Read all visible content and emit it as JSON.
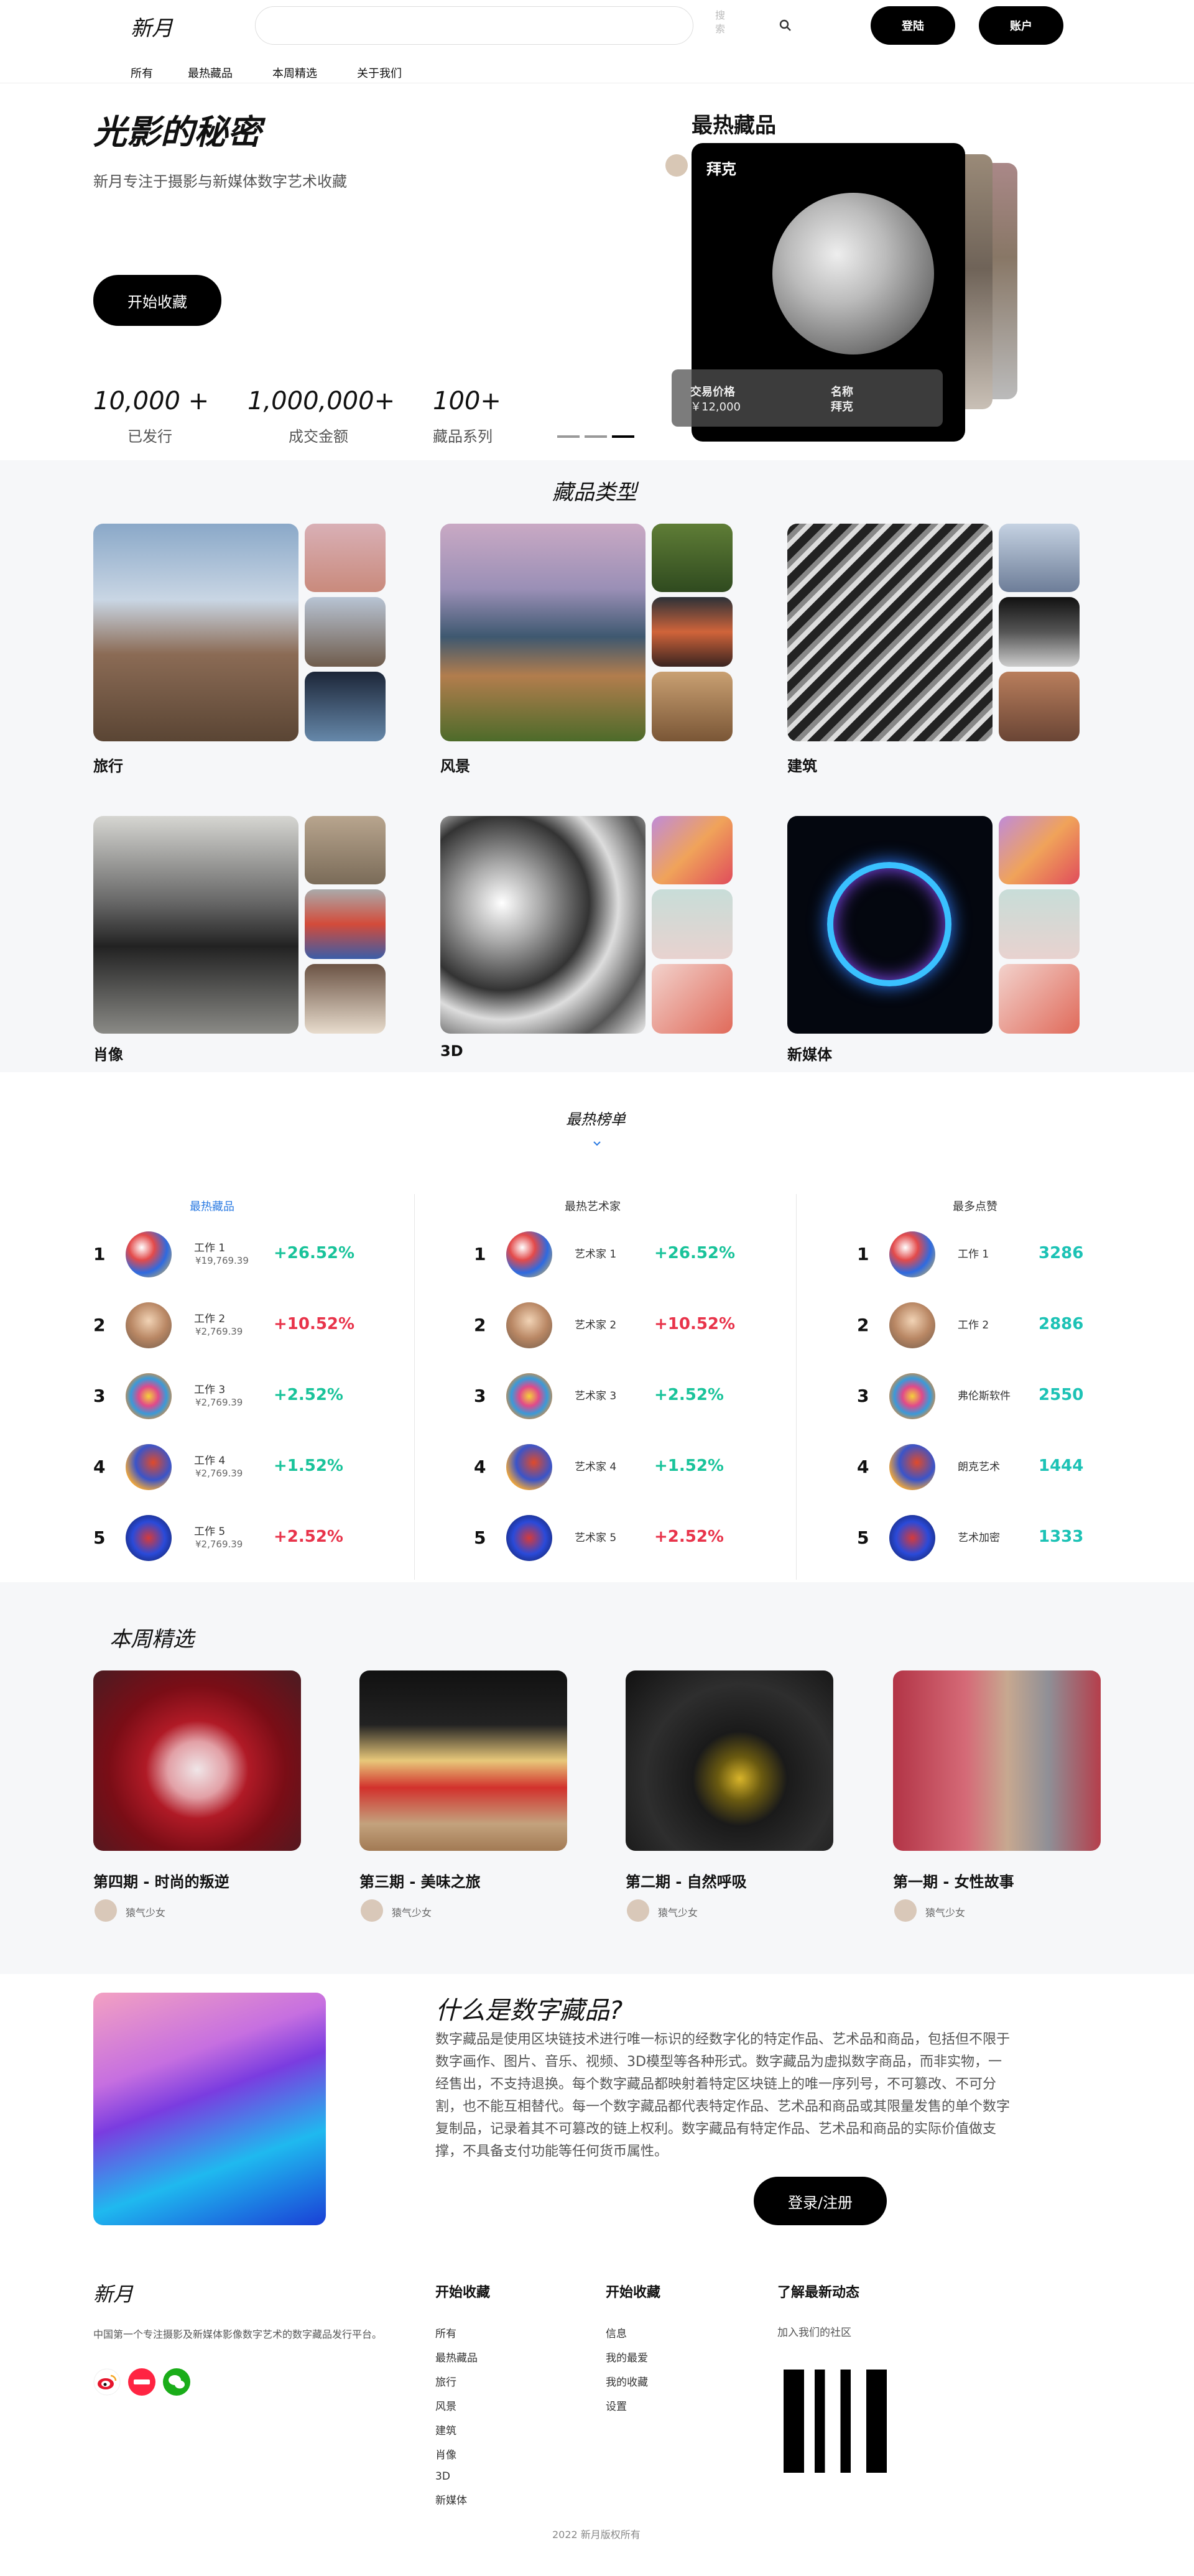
{
  "header": {
    "logo": "新月",
    "search_placeholder": "",
    "search_button": "搜索",
    "login_button": "登陆",
    "account_button": "账户",
    "nav": [
      "所有",
      "最热藏品",
      "本周精选",
      "关于我们"
    ]
  },
  "hero": {
    "title": "光影的秘密",
    "subtitle": "新月专注于摄影与新媒体数字艺术收藏",
    "cta": "开始收藏",
    "stats": [
      {
        "value": "10,000 +",
        "label": "已发行"
      },
      {
        "value": "1,000,000+",
        "label": "成交金额"
      },
      {
        "value": "100+",
        "label": "藏品系列"
      }
    ],
    "featured_title": "最热藏品",
    "featured_artist": "拜克",
    "featured_price_label": "交易价格",
    "featured_price": "￥12,000",
    "featured_name_label": "名称",
    "featured_name": "拜克"
  },
  "categories": {
    "title": "藏品类型",
    "items": [
      "旅行",
      "风景",
      "建筑",
      "肖像",
      "3D",
      "新媒体"
    ]
  },
  "rankings": {
    "title": "最热榜单",
    "columns": [
      {
        "heading": "最热藏品",
        "rows": [
          {
            "rank": "1",
            "name": "工作 1",
            "sub": "¥19,769.39",
            "value": "+26.52%"
          },
          {
            "rank": "2",
            "name": "工作 2",
            "sub": "¥2,769.39",
            "value": "+10.52%"
          },
          {
            "rank": "3",
            "name": "工作 3",
            "sub": "¥2,769.39",
            "value": "+2.52%"
          },
          {
            "rank": "4",
            "name": "工作 4",
            "sub": "¥2,769.39",
            "value": "+1.52%"
          },
          {
            "rank": "5",
            "name": "工作 5",
            "sub": "¥2,769.39",
            "value": "+2.52%"
          }
        ]
      },
      {
        "heading": "最热艺术家",
        "rows": [
          {
            "rank": "1",
            "name": "艺术家 1",
            "value": "+26.52%"
          },
          {
            "rank": "2",
            "name": "艺术家 2",
            "value": "+10.52%"
          },
          {
            "rank": "3",
            "name": "艺术家 3",
            "value": "+2.52%"
          },
          {
            "rank": "4",
            "name": "艺术家 4",
            "value": "+1.52%"
          },
          {
            "rank": "5",
            "name": "艺术家 5",
            "value": "+2.52%"
          }
        ]
      },
      {
        "heading": "最多点赞",
        "rows": [
          {
            "rank": "1",
            "name": "工作 1",
            "value": "3286"
          },
          {
            "rank": "2",
            "name": "工作 2",
            "value": "2886"
          },
          {
            "rank": "3",
            "name": "弗伦斯软件",
            "value": "2550"
          },
          {
            "rank": "4",
            "name": "朗克艺术",
            "value": "1444"
          },
          {
            "rank": "5",
            "name": "艺术加密",
            "value": "1333"
          }
        ]
      }
    ]
  },
  "weekly": {
    "title": "本周精选",
    "items": [
      {
        "title": "第四期 - 时尚的叛逆",
        "author": "猿气少女"
      },
      {
        "title": "第三期 - 美味之旅",
        "author": "猿气少女"
      },
      {
        "title": "第二期 - 自然呼吸",
        "author": "猿气少女"
      },
      {
        "title": "第一期 - 女性故事",
        "author": "猿气少女"
      }
    ]
  },
  "about": {
    "title": "什么是数字藏品?",
    "body": "数字藏品是使用区块链技术进行唯一标识的经数字化的特定作品、艺术品和商品，包括但不限于数字画作、图片、音乐、视频、3D模型等各种形式。数字藏品为虚拟数字商品，而非实物，一经售出，不支持退换。每个数字藏品都映射着特定区块链上的唯一序列号，不可篡改、不可分割，也不能互相替代。每一个数字藏品都代表特定作品、艺术品和商品或其限量发售的单个数字复制品，记录着其不可篡改的链上权利。数字藏品有特定作品、艺术品和商品的实际价值做支撑，不具备支付功能等任何货币属性。",
    "cta": "登录/注册"
  },
  "footer": {
    "logo": "新月",
    "tagline": "中国第一个专注摄影及新媒体影像数字艺术的数字藏品发行平台。",
    "col1_title": "开始收藏",
    "col1_links": [
      "所有",
      "最热藏品",
      "旅行",
      "风景",
      "建筑",
      "肖像",
      "3D",
      "新媒体"
    ],
    "col2_title": "开始收藏",
    "col2_links": [
      "信息",
      "我的最爱",
      "我的收藏",
      "设置"
    ],
    "col3_title": "了解最新动态",
    "col3_sub": "加入我们的社区",
    "copyright": "2022 新月版权所有"
  }
}
